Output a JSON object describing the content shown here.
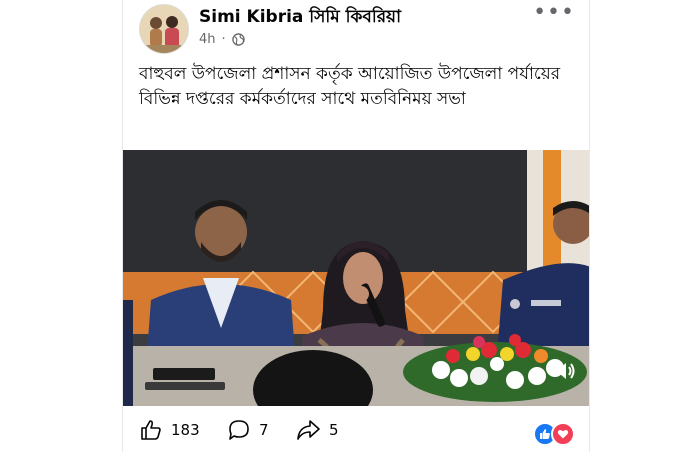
{
  "post": {
    "author": "Simi Kibria সিমি কিবরিয়া",
    "time": "4h",
    "privacy_icon": "globe-icon",
    "text": "বাহুবল উপজেলা প্রশাসন কর্তৃক আয়োজিত উপজেলা পর্যায়ের বিভিন্ন দপ্তরের কর্মকর্তাদের সাথে মতবিনিময় সভা"
  },
  "actions": {
    "likes": "183",
    "comments": "7",
    "shares": "5"
  },
  "colors": {
    "accent_blue": "#1877f2",
    "love_red": "#f33e58",
    "meta_gray": "#65676b"
  }
}
